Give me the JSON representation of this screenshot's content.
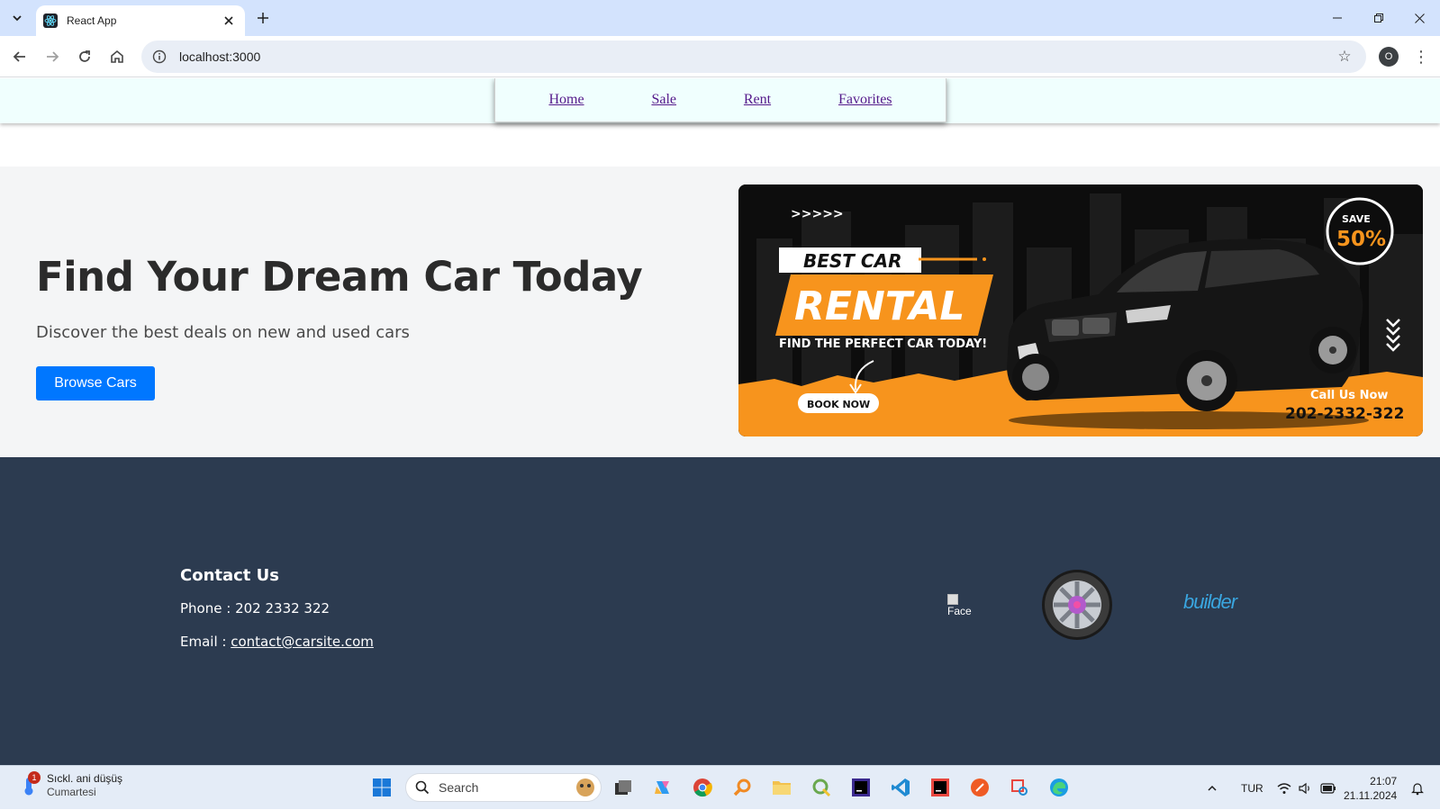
{
  "browser": {
    "tab_title": "React App",
    "url": "localhost:3000",
    "profile_initial": "O"
  },
  "nav": {
    "links": [
      "Home",
      "Sale",
      "Rent",
      "Favorites"
    ]
  },
  "hero": {
    "title": "Find Your Dream Car Today",
    "subtitle": "Discover the best deals on new and used cars",
    "button": "Browse Cars"
  },
  "banner": {
    "arrows": ">>>>>",
    "headline_top": "BEST CAR",
    "headline_main": "RENTAL",
    "tagline": "FIND THE PERFECT CAR TODAY!",
    "cta": "BOOK NOW",
    "save_label": "SAVE",
    "save_value": "50%",
    "call_label": "Call Us Now",
    "phone": "202-2332-322"
  },
  "footer": {
    "contact_title": "Contact Us",
    "phone_label": "Phone :",
    "phone_value": "202 2332 322",
    "email_label": "Email :",
    "email_value": "contact@carsite.com",
    "social_alt": "Face",
    "brand_text": "builder"
  },
  "taskbar": {
    "weather_main": "Sıckl. ani düşüş",
    "weather_sub": "Cumartesi",
    "weather_badge": "1",
    "search_placeholder": "Search",
    "language": "TUR",
    "time": "21:07",
    "date": "21.11.2024"
  },
  "colors": {
    "nav_bg": "#f0fffe",
    "link": "#551a8b",
    "button": "#0077ff",
    "footer_bg": "#2c3b50",
    "banner_orange": "#f7941d"
  }
}
